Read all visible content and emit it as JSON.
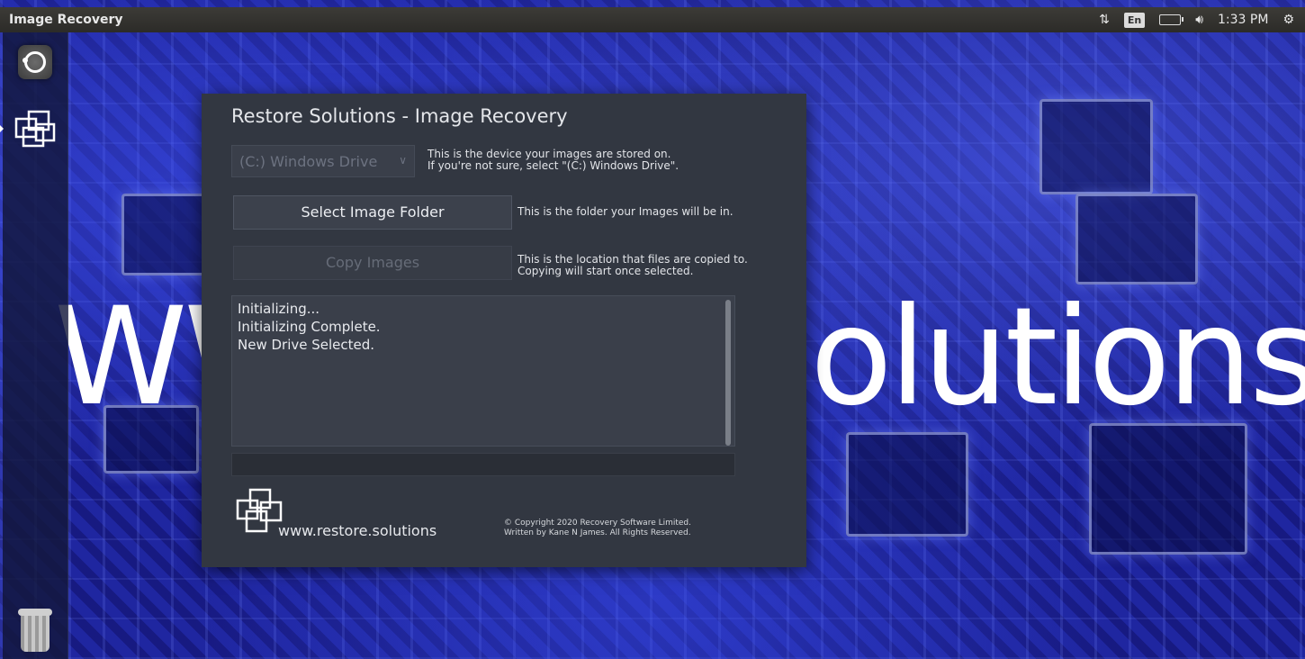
{
  "topbar": {
    "title": "Image Recovery",
    "lang": "En",
    "time": "1:33 PM"
  },
  "desktop": {
    "bg_text_left": "WW",
    "bg_text_right": "olutions"
  },
  "window": {
    "title": "Restore Solutions - Image Recovery",
    "drive_select": {
      "value": "(C:) Windows Drive"
    },
    "drive_hint": [
      "This is the device your images are stored on.",
      "If you're not sure, select \"(C:) Windows Drive\"."
    ],
    "select_folder_label": "Select Image Folder",
    "folder_hint": "This is the folder your Images will be in.",
    "copy_images_label": "Copy Images",
    "copy_hint": [
      "This is the location that files are copied to.",
      "Copying will start once selected."
    ],
    "log_lines": [
      "Initializing...",
      "Initializing Complete.",
      "New Drive Selected."
    ],
    "progress": 0,
    "brand_url": "www.restore.solutions",
    "copyright": [
      "© Copyright 2020 Recovery Software Limited.",
      "Written by Kane N James. All Rights Reserved."
    ]
  },
  "colors": {
    "window_bg": "#323741",
    "accent_blue": "#1a1f8a"
  }
}
